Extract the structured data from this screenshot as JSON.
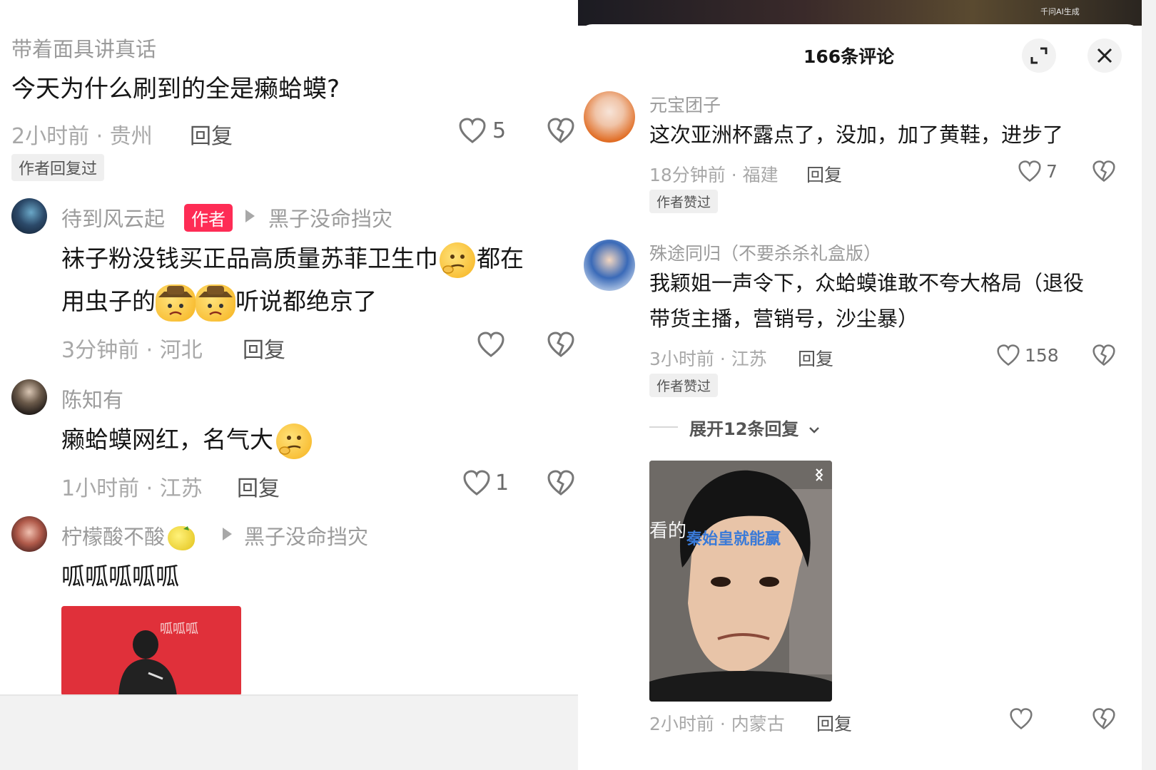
{
  "left_thread": {
    "top_comment": {
      "username": "带着面具讲真话",
      "text": "今天为什么刷到的全是癞蛤蟆?",
      "time_location": "2小时前 · 贵州",
      "reply_label": "回复",
      "likes": "5",
      "badge": "作者回复过"
    },
    "replies": [
      {
        "username": "待到风云起",
        "author_tag": "作者",
        "reply_to": "黑子没命挡灾",
        "text_line1_a": "袜子粉没钱买正品高质量苏菲卫生巾",
        "text_line1_b": "都在",
        "text_line2_a": "用虫子的",
        "text_line2_b": "听说都绝京了",
        "time_location": "3分钟前 · 河北",
        "reply_label": "回复"
      },
      {
        "username": "陈知有",
        "text": "癞蛤蟆网红，名气大",
        "time_location": "1小时前 · 江苏",
        "reply_label": "回复",
        "likes": "1"
      },
      {
        "username": "柠檬酸不酸",
        "reply_to": "黑子没命挡灾",
        "text": "呱呱呱呱呱",
        "image_caption": "呱呱呱"
      }
    ]
  },
  "right_panel": {
    "header": {
      "title": "166条评论",
      "expand_icon": "expand-icon",
      "close_icon": "close-icon"
    },
    "comments": [
      {
        "username": "元宝团子",
        "text": "这次亚洲杯露点了，没加，加了黄鞋，进步了",
        "time_location": "18分钟前 · 福建",
        "reply_label": "回复",
        "likes": "7",
        "badge": "作者赞过"
      },
      {
        "username": "殊途同归（不要杀杀礼盒版）",
        "text_line1": "我颖姐一声令下，众蛤蟆谁敢不夸大格局（退役",
        "text_line2": "带货主播，营销号，沙尘暴）",
        "time_location": "3小时前 · 江苏",
        "reply_label": "回复",
        "likes": "158",
        "badge": "作者赞过",
        "expand_replies": "展开12条回复"
      },
      {
        "image_overlay_prefix": "看的",
        "image_overlay_text": "秦始皇就能赢",
        "time_location": "2小时前 · 内蒙古",
        "reply_label": "回复"
      }
    ],
    "watermark": "千问AI生成"
  },
  "colors": {
    "author_tag": "#fe2c55",
    "meta_text": "#a8a8a8",
    "username": "#9b9b9b",
    "body_text": "#161616"
  }
}
